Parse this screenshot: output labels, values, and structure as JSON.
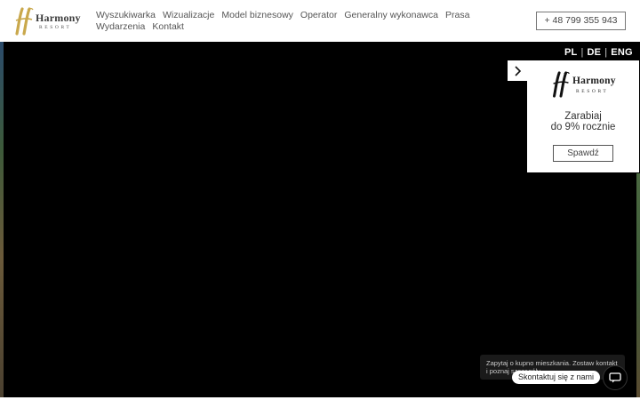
{
  "brand": {
    "name": "Harmony",
    "sub": "RESORT",
    "gold": "#c9a84c"
  },
  "nav": {
    "items": [
      {
        "label": "Wyszukiwarka"
      },
      {
        "label": "Wizualizacje"
      },
      {
        "label": "Model biznesowy"
      },
      {
        "label": "Operator"
      },
      {
        "label": "Generalny wykonawca"
      },
      {
        "label": "Prasa"
      },
      {
        "label": "Wydarzenia"
      },
      {
        "label": "Kontakt"
      }
    ]
  },
  "phone": "+ 48 799 355 943",
  "languages": {
    "pl": "PL",
    "de": "DE",
    "eng": "ENG",
    "separator": "|"
  },
  "promo": {
    "toggle_icon": "chevron-right-icon",
    "title_line1": "Zarabiaj",
    "title_line2": "do 9% rocznie",
    "button": "Spawdź"
  },
  "chat": {
    "bubble_text": "Zapytaj o kupno mieszkania. Zostaw kontakt i poznaj szczegóły.",
    "label": "Skontaktuj się z nami",
    "icon": "chat-icon"
  }
}
